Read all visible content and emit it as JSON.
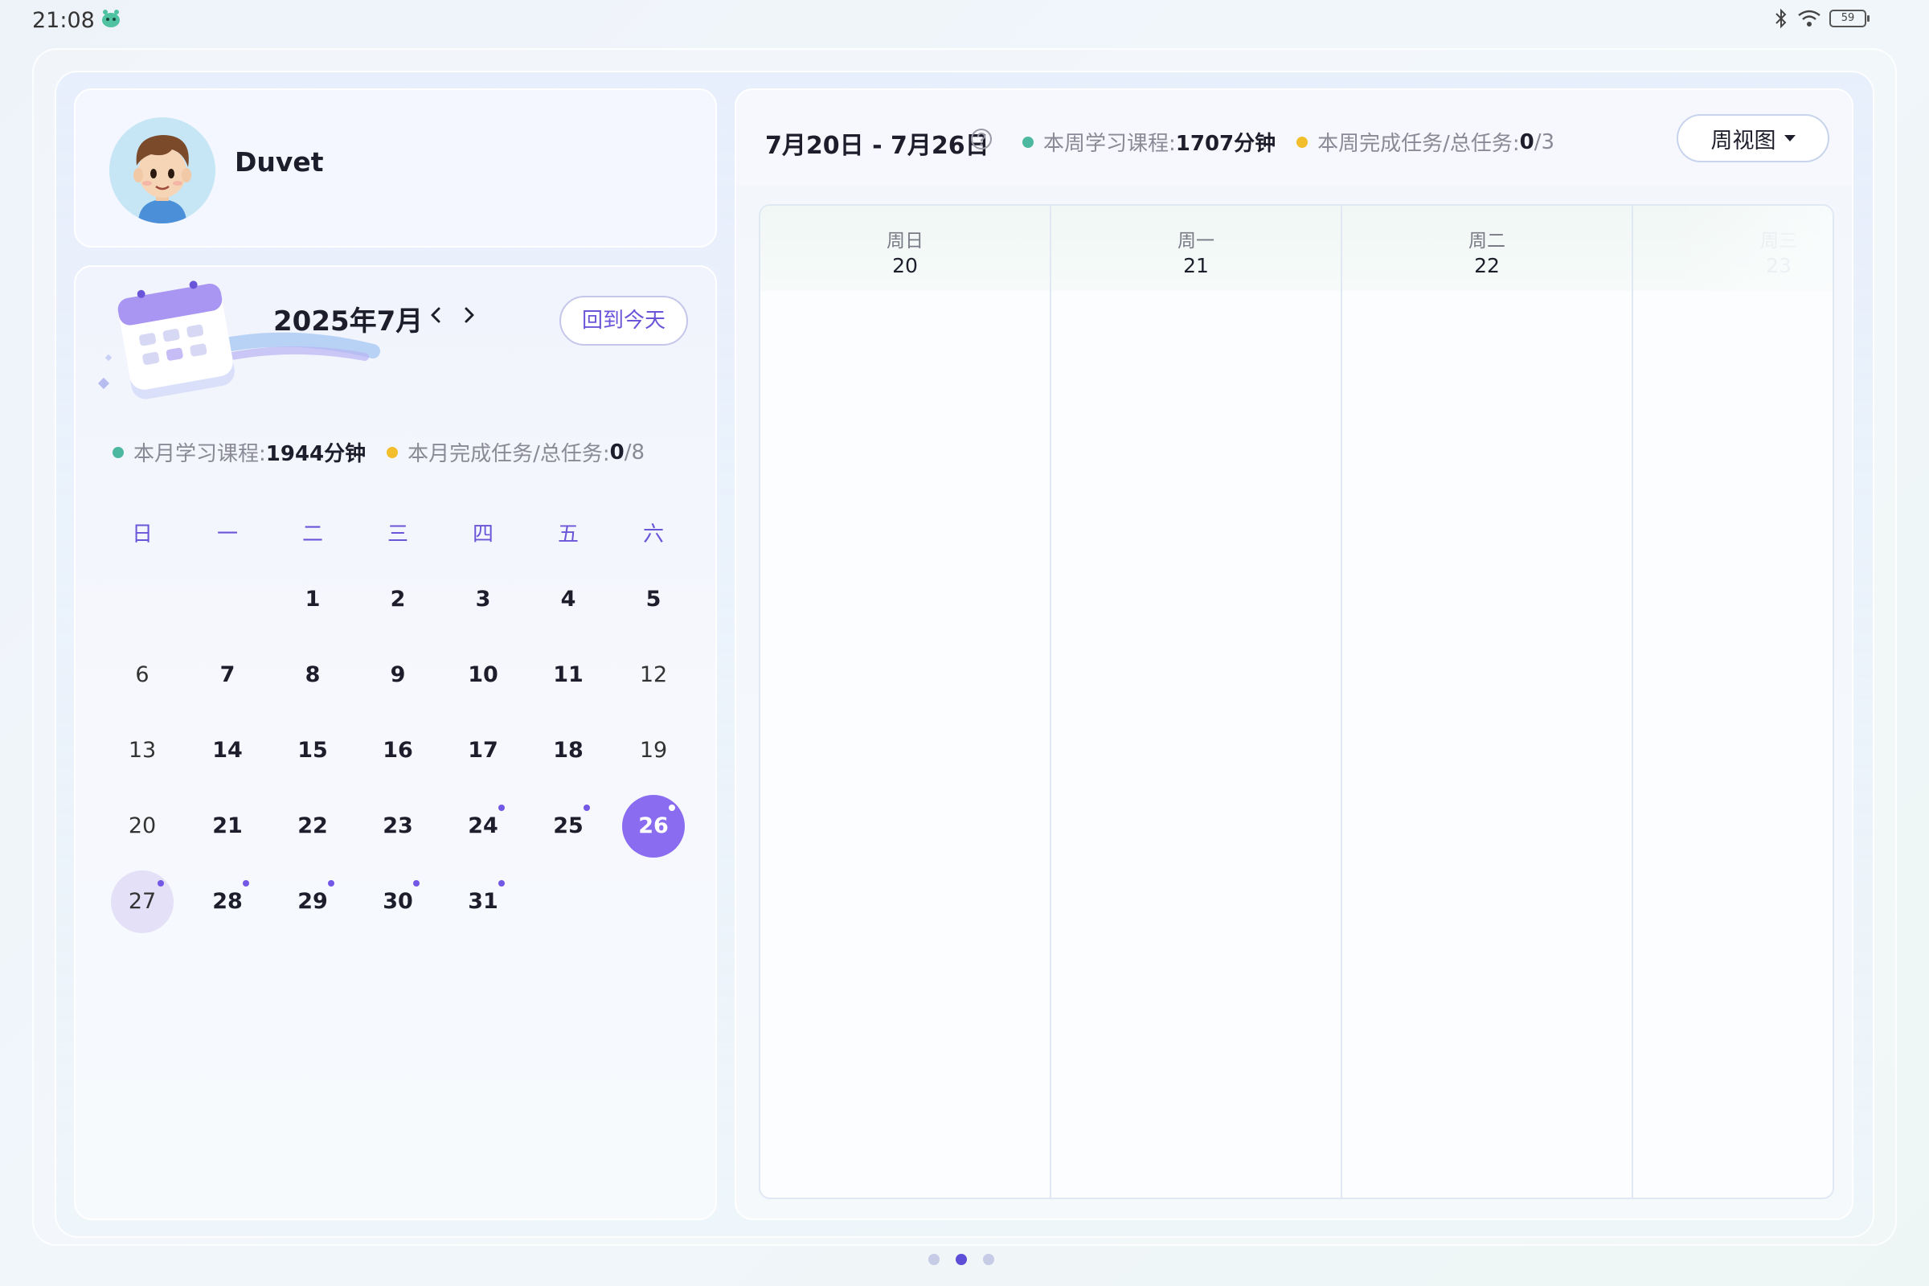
{
  "status": {
    "time": "21:08",
    "battery": "59"
  },
  "profile": {
    "name": "Duvet"
  },
  "calendar": {
    "month_title": "2025年7月",
    "today_label": "回到今天",
    "stats": {
      "study_label": "本月学习课程:",
      "study_value": "1944分钟",
      "task_label": "本月完成任务/总任务:",
      "task_done": "0",
      "task_total": "/8"
    },
    "weekdays": [
      "日",
      "一",
      "二",
      "三",
      "四",
      "五",
      "六"
    ],
    "weeks": [
      [
        null,
        null,
        {
          "d": "1"
        },
        {
          "d": "2"
        },
        {
          "d": "3"
        },
        {
          "d": "4"
        },
        {
          "d": "5"
        }
      ],
      [
        {
          "d": "6",
          "light": true
        },
        {
          "d": "7"
        },
        {
          "d": "8"
        },
        {
          "d": "9"
        },
        {
          "d": "10"
        },
        {
          "d": "11"
        },
        {
          "d": "12",
          "light": true
        }
      ],
      [
        {
          "d": "13",
          "light": true
        },
        {
          "d": "14"
        },
        {
          "d": "15"
        },
        {
          "d": "16"
        },
        {
          "d": "17"
        },
        {
          "d": "18"
        },
        {
          "d": "19",
          "light": true
        }
      ],
      [
        {
          "d": "20",
          "light": true
        },
        {
          "d": "21"
        },
        {
          "d": "22"
        },
        {
          "d": "23"
        },
        {
          "d": "24",
          "mark": true
        },
        {
          "d": "25",
          "mark": true
        },
        {
          "d": "26",
          "mark": true,
          "selected": true
        }
      ],
      [
        {
          "d": "27",
          "mark": true,
          "today": true,
          "light": true
        },
        {
          "d": "28",
          "mark": true
        },
        {
          "d": "29",
          "mark": true
        },
        {
          "d": "30",
          "mark": true
        },
        {
          "d": "31",
          "mark": true
        },
        null,
        null
      ]
    ]
  },
  "week": {
    "range": "7月20日 - 7月26日",
    "stats": {
      "study_label": "本周学习课程:",
      "study_value": "1707分钟",
      "task_label": "本周完成任务/总任务:",
      "task_done": "0",
      "task_total": "/3"
    },
    "view_label": "周视图",
    "columns": [
      {
        "dow": "周日",
        "date": "20"
      },
      {
        "dow": "周一",
        "date": "21"
      },
      {
        "dow": "周二",
        "date": "22"
      },
      {
        "dow": "周三",
        "date": "23"
      }
    ]
  },
  "pager": {
    "count": 3,
    "active": 1
  }
}
